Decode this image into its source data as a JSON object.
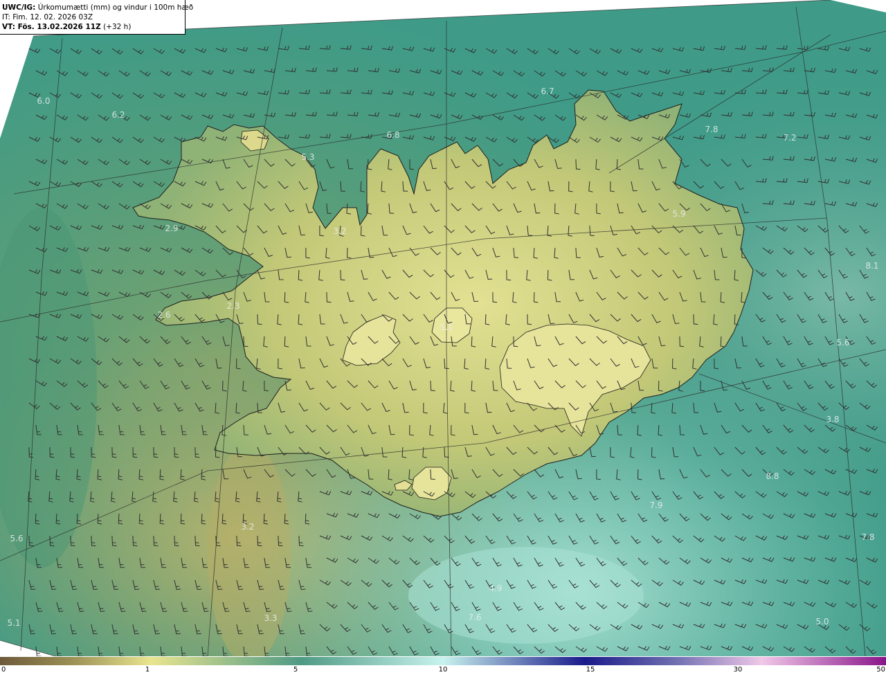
{
  "header": {
    "model_label": "UWC/IG:",
    "title": "Úrkomumætti (mm) og vindur i 100m hæð",
    "init_time": "IT: Fim. 12. 02. 2026 03Z",
    "valid_prefix": "VT: Fös. 13.02.2026 11Z",
    "valid_offset": "(+32 h)"
  },
  "colors": {
    "ocean": "#3c9a88",
    "land": "#c9cc76",
    "land_high": "#dedd8e",
    "west_sea": "#5f9b6a",
    "south_sea": "#7ec8b6",
    "coast": "#1d1d1d",
    "grid": "#333333",
    "barb": "#303030"
  },
  "map_labels": [
    {
      "text": "6.0"
    },
    {
      "text": "6.2"
    },
    {
      "text": "6.8"
    },
    {
      "text": "6.7"
    },
    {
      "text": "7.8"
    },
    {
      "text": "7.2"
    },
    {
      "text": "5.3"
    },
    {
      "text": "3.2"
    },
    {
      "text": "2.9"
    },
    {
      "text": "5.9"
    },
    {
      "text": "8.1"
    },
    {
      "text": "2.3"
    },
    {
      "text": "2.6"
    },
    {
      "text": "5.1"
    },
    {
      "text": "5.6"
    },
    {
      "text": "3.8"
    },
    {
      "text": "8.8"
    },
    {
      "text": "7.9"
    },
    {
      "text": "3.2"
    },
    {
      "text": "5.6"
    },
    {
      "text": "7.8"
    },
    {
      "text": "4.9"
    },
    {
      "text": "3.3"
    },
    {
      "text": "7.6"
    },
    {
      "text": "5.0"
    },
    {
      "text": "5.1"
    }
  ],
  "colorbar": {
    "ticks": [
      "0",
      "1",
      "5",
      "10",
      "15",
      "30",
      "50"
    ],
    "stops": [
      "#6e5a3a",
      "#9a8f55",
      "#e9e58f",
      "#4f9a84",
      "#c8f3ee",
      "#1a1a8a",
      "#6d6db0",
      "#f0c8e8",
      "#8a158a"
    ]
  }
}
